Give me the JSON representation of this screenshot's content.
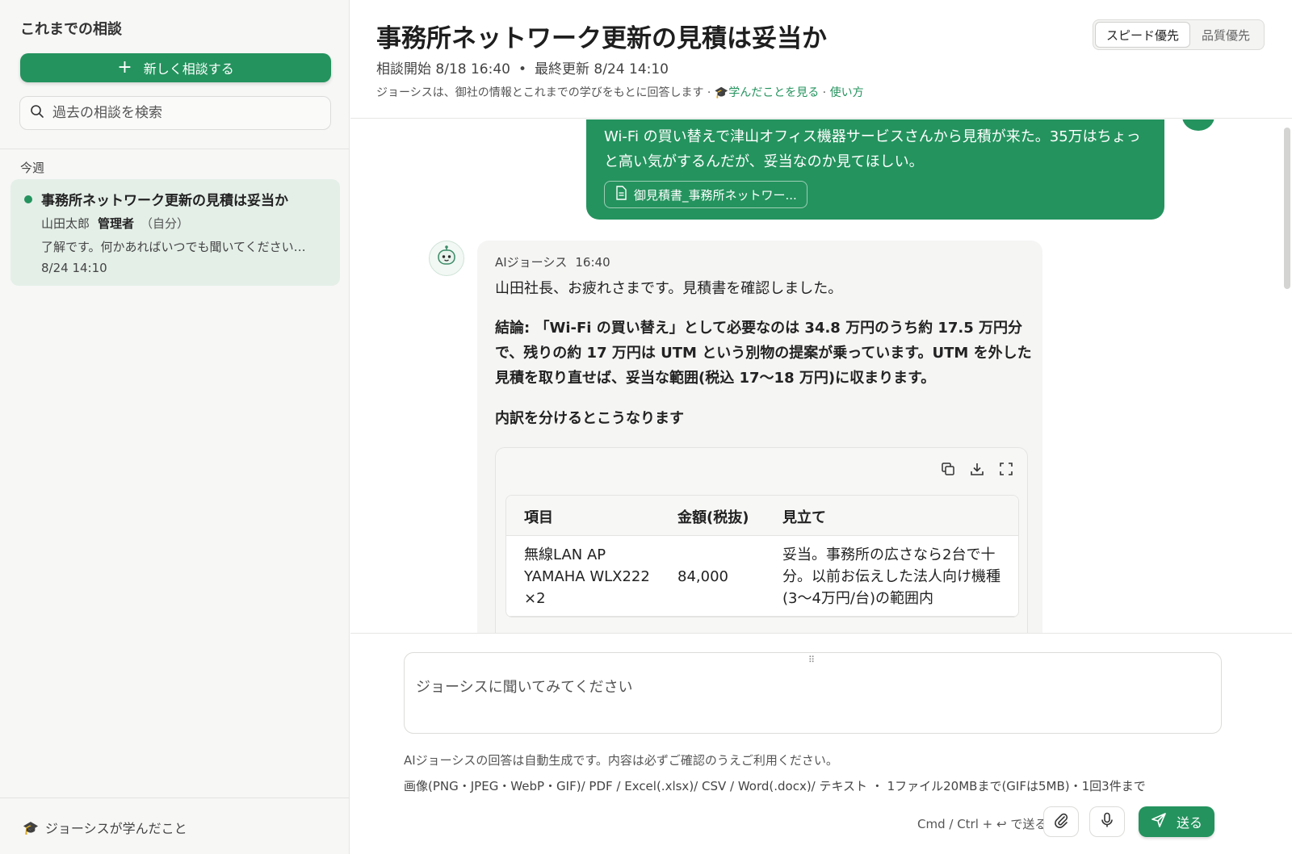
{
  "sidebar": {
    "title": "これまでの相談",
    "new_button": "新しく相談する",
    "search_placeholder": "過去の相談を検索",
    "group_label": "今週",
    "conversations": [
      {
        "title": "事務所ネットワーク更新の見積は妥当か",
        "owner": "山田太郎",
        "role": "管理者",
        "self_tag": "（自分）",
        "preview": "了解です。何かあればいつでも聞いてください…",
        "time": "8/24 14:10"
      }
    ],
    "learned_link": "ジョーシスが学んだこと"
  },
  "header": {
    "title": "事務所ネットワーク更新の見積は妥当か",
    "started": "相談開始 8/18 16:40",
    "updated": "最終更新 8/24 14:10",
    "meta_sep": "•",
    "info_text": "ジョーシスは、御社の情報とこれまでの学びをもとに回答します · 🎓",
    "learned_link": "学んだことを見る",
    "dot": " · ",
    "usage_link": "使い方",
    "mode_options": [
      "スピード優先",
      "品質優先"
    ],
    "mode_selected": "スピード優先"
  },
  "chat": {
    "user_message": {
      "text": "Wi-Fi の買い替えで津山オフィス機器サービスさんから見積が来た。35万はちょっと高い気がするんだが、妥当なのか見てほしい。",
      "attachment": "御見積書_事務所ネットワー..."
    },
    "ai_message": {
      "sender": "AIジョーシス",
      "time": "16:40",
      "greeting": "山田社長、お疲れさまです。見積書を確認しました。",
      "conclusion": "結論: 「Wi-Fi の買い替え」として必要なのは 34.8 万円のうち約 17.5 万円分で、残りの約 17 万円は UTM という別物の提案が乗っています。UTM を外した見積を取り直せば、妥当な範囲(税込 17〜18 万円)に収まります。",
      "breakdown_intro": "内訳を分けるとこうなります",
      "table": {
        "headers": [
          "項目",
          "金額(税抜)",
          "見立て"
        ],
        "rows": [
          {
            "item": "無線LAN AP YAMAHA WLX222 ×2",
            "amount": "84,000",
            "assessment": "妥当。事務所の広さなら2台で十分。以前お伝えした法人向け機種(3〜4万円/台)の範囲内"
          }
        ]
      }
    }
  },
  "composer": {
    "placeholder": "ジョーシスに聞いてみてください",
    "disclaimer": "AIジョーシスの回答は自動生成です。内容は必ずご確認のうえご利用ください。",
    "file_types": "画像(PNG・JPEG・WebP・GIF)/ PDF / Excel(.xlsx)/ CSV / Word(.docx)/ テキスト ・ 1ファイル20MBまで(GIFは5MB)・1回3件まで",
    "shortcut_hint": "Cmd / Ctrl + ↩ で送る",
    "send_label": "送る"
  },
  "colors": {
    "accent": "#24935e",
    "selected_bg": "#e4efe8",
    "sidebar_bg": "#f7f7f6"
  },
  "icons": [
    "plus-icon",
    "search-icon",
    "graduation-cap-icon",
    "document-icon",
    "robot-icon",
    "copy-icon",
    "download-icon",
    "expand-icon",
    "paperclip-icon",
    "microphone-icon",
    "send-icon",
    "drag-handle-icon"
  ]
}
